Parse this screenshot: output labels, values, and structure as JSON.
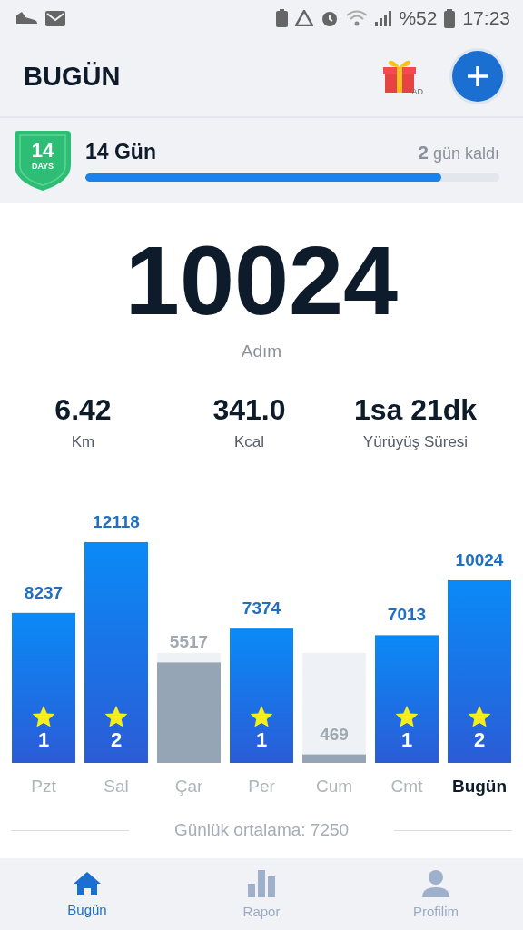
{
  "status_bar": {
    "battery": "%52",
    "time": "17:23"
  },
  "header": {
    "title": "BUGÜN",
    "ad_badge": "AD"
  },
  "streak": {
    "badge_number": "14",
    "badge_unit": "DAYS",
    "title": "14 Gün",
    "remaining": "**2** gün kaldı",
    "level": 0.86
  },
  "steps": {
    "value": "10024",
    "label": "Adım"
  },
  "stats": [
    {
      "value": "6.42",
      "label": "Km"
    },
    {
      "value": "341.0",
      "label": "Kcal"
    },
    {
      "value": "1sa 21dk",
      "label": "Yürüyüş Süresi"
    }
  ],
  "chart": {
    "chart_data": {
      "type": "bar",
      "categories": [
        "Pzt",
        "Sal",
        "Çar",
        "Per",
        "Cum",
        "Cmt",
        "Bugün"
      ],
      "values": [
        8237,
        12118,
        5517,
        7374,
        469,
        7013,
        10024
      ],
      "data_labels": true
    },
    "days": [
      {
        "goal_met": true,
        "star_count": "1",
        "selected": false
      },
      {
        "goal_met": true,
        "star_count": "2",
        "selected": false
      },
      {
        "goal_met": false,
        "selected": false
      },
      {
        "goal_met": true,
        "star_count": "1",
        "selected": false
      },
      {
        "goal_met": false,
        "selected": false
      },
      {
        "goal_met": true,
        "star_count": "1",
        "selected": false
      },
      {
        "goal_met": true,
        "star_count": "2",
        "selected": true
      }
    ]
  },
  "average": "Günlük ortalama: 7250",
  "nav": [
    {
      "label": "Bugün",
      "selected": true
    },
    {
      "label": "Rapor",
      "selected": false
    },
    {
      "label": "Profilim",
      "selected": false
    }
  ]
}
